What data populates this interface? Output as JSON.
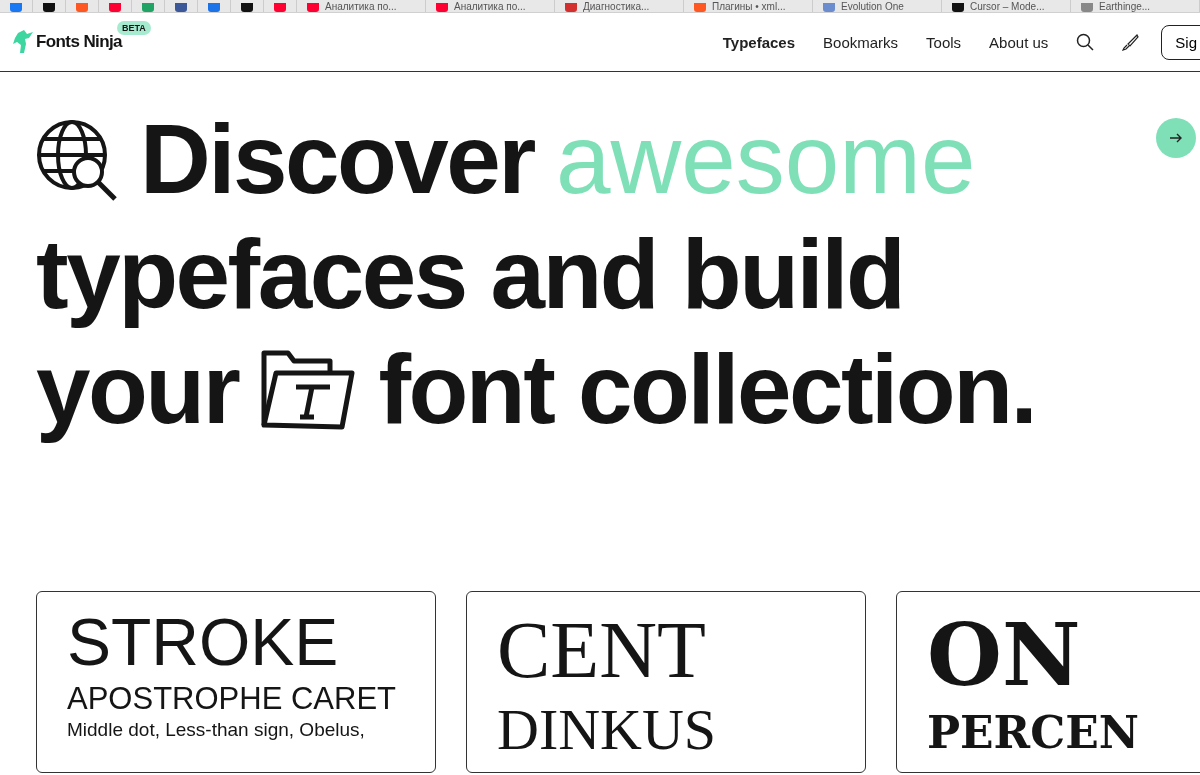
{
  "browser_tabs": [
    {
      "color": "#1877f2"
    },
    {
      "color": "#111111"
    },
    {
      "color": "#ff5722"
    },
    {
      "color": "#ff0033"
    },
    {
      "color": "#21a366"
    },
    {
      "color": "#3b5998"
    },
    {
      "color": "#1a73e8"
    },
    {
      "color": "#111111"
    },
    {
      "color": "#ff0033"
    },
    {
      "title": "Аналитика по...",
      "color": "#ff0033"
    },
    {
      "title": "Аналитика по...",
      "color": "#ff0033"
    },
    {
      "title": "Диагностика...",
      "color": "#d32f2f"
    },
    {
      "title": "Плагины • xml...",
      "color": "#ff5722"
    },
    {
      "title": "Evolution One",
      "color": "#6b8cce"
    },
    {
      "title": "Cursor – Mode...",
      "color": "#111111"
    },
    {
      "title": "Earthinge...",
      "color": "#888888"
    }
  ],
  "header": {
    "logo": "Fonts Ninja",
    "badge": "BETA",
    "nav": [
      {
        "label": "Typefaces",
        "selected": true
      },
      {
        "label": "Bookmarks",
        "selected": false
      },
      {
        "label": "Tools",
        "selected": false
      },
      {
        "label": "About us",
        "selected": false
      }
    ],
    "sign_button": "Sig"
  },
  "hero": {
    "line1": "Discover",
    "accent": "awesome",
    "line2": "typefaces and build",
    "line3a": "your",
    "line3b": "font collection."
  },
  "cards": [
    {
      "kind": "sans",
      "lines": [
        "STROKE",
        "APOSTROPHE CARET",
        "Middle dot, Less-than sign, Obelus,"
      ]
    },
    {
      "kind": "serif",
      "lines": [
        "CENT",
        "DINKUS"
      ]
    },
    {
      "kind": "slab",
      "lines": [
        "ON",
        "PERCEN"
      ]
    }
  ]
}
